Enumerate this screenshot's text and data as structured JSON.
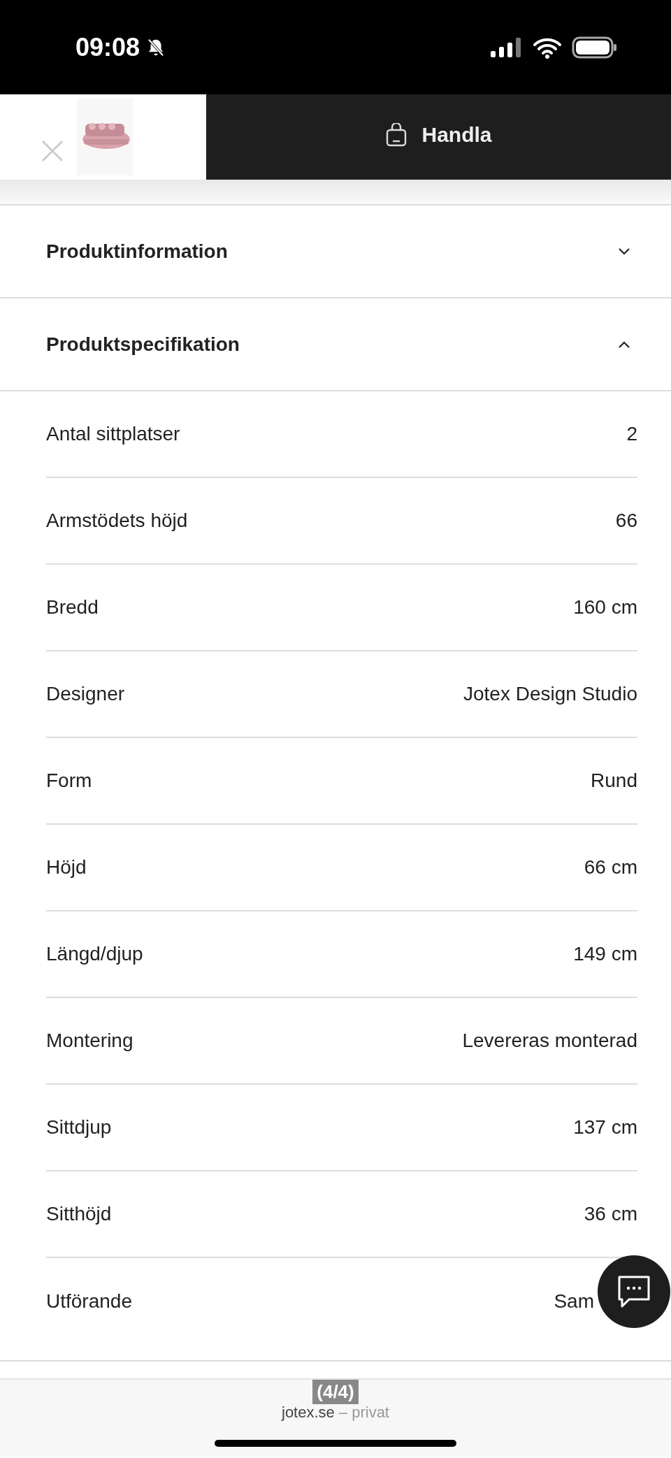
{
  "status_bar": {
    "time": "09:08"
  },
  "header": {
    "action": "Handla"
  },
  "sections": [
    {
      "title": "Produktinformation",
      "expanded": false
    },
    {
      "title": "Produktspecifikation",
      "expanded": true,
      "rows": [
        {
          "label": "Antal sittplatser",
          "value": "2"
        },
        {
          "label": "Armstödets höjd",
          "value": "66"
        },
        {
          "label": "Bredd",
          "value": "160 cm"
        },
        {
          "label": "Designer",
          "value": "Jotex Design Studio"
        },
        {
          "label": "Form",
          "value": "Rund"
        },
        {
          "label": "Höjd",
          "value": "66 cm"
        },
        {
          "label": "Längd/djup",
          "value": "149 cm"
        },
        {
          "label": "Montering",
          "value": "Levereras monterad"
        },
        {
          "label": "Sittdjup",
          "value": "137 cm"
        },
        {
          "label": "Sitthöjd",
          "value": "36 cm"
        },
        {
          "label": "Utförande",
          "value": "Sam"
        }
      ]
    }
  ],
  "page_counter": "(4/4)",
  "browser": {
    "domain": "jotex.se",
    "separator": "–",
    "mode": "privat"
  }
}
